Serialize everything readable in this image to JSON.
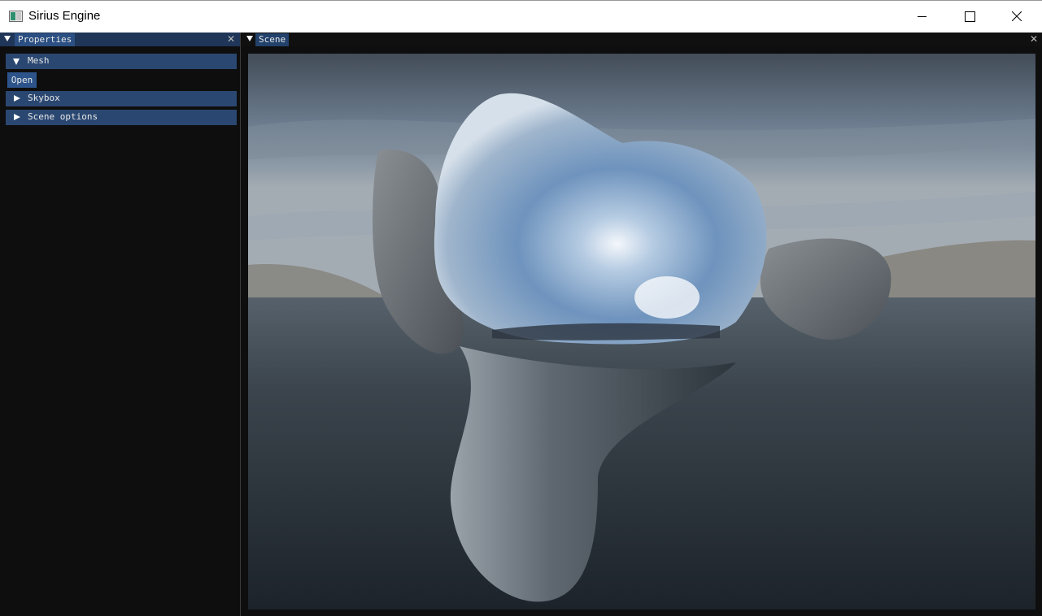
{
  "window": {
    "title": "Sirius Engine",
    "icon": "app-icon",
    "controls": [
      "minimize-icon",
      "maximize-icon",
      "close-icon"
    ]
  },
  "properties_panel": {
    "tab_label": "Properties",
    "close_glyph": "✕",
    "sections": [
      {
        "label": "Mesh",
        "expanded": true
      },
      {
        "label": "Skybox",
        "expanded": false
      },
      {
        "label": "Scene options",
        "expanded": false
      }
    ],
    "open_button": "Open"
  },
  "scene_panel": {
    "tab_label": "Scene",
    "close_glyph": "✕"
  },
  "colors": {
    "active_tab": "#2b4f82",
    "header": "#2a4771",
    "button": "#2d548a",
    "panel_bg": "#0e0e0e"
  }
}
